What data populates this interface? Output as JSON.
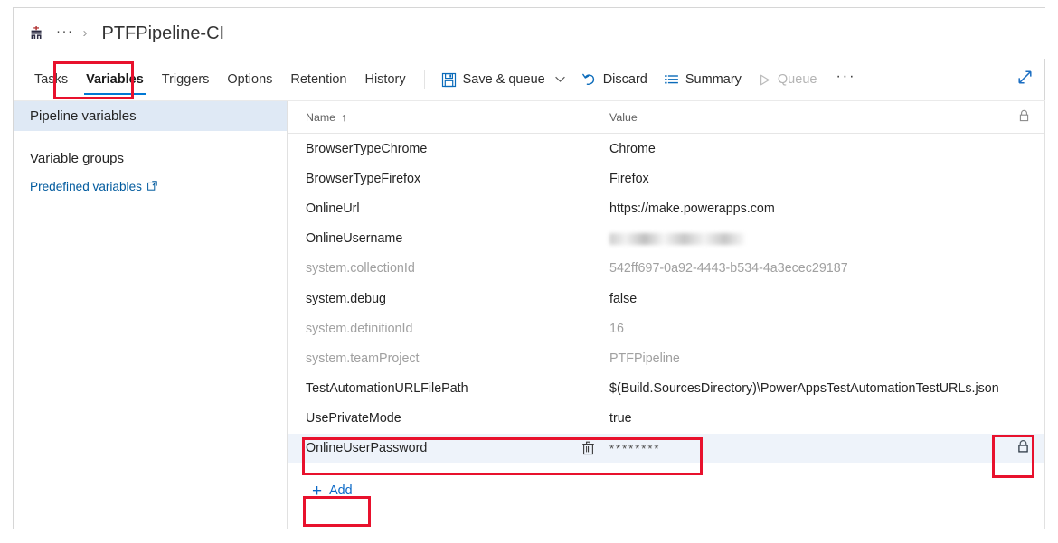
{
  "breadcrumb": {
    "pipeline_icon": "build-pipeline-icon",
    "ellipsis": "···",
    "separator": "›",
    "title": "PTFPipeline-CI"
  },
  "tabs": [
    {
      "label": "Tasks",
      "active": false
    },
    {
      "label": "Variables",
      "active": true
    },
    {
      "label": "Triggers",
      "active": false
    },
    {
      "label": "Options",
      "active": false
    },
    {
      "label": "Retention",
      "active": false
    },
    {
      "label": "History",
      "active": false
    }
  ],
  "commands": {
    "save_queue": "Save & queue",
    "discard": "Discard",
    "summary": "Summary",
    "queue": "Queue",
    "overflow": "···",
    "expand": "expand-icon"
  },
  "sidebar": {
    "items": [
      {
        "label": "Pipeline variables",
        "selected": true
      },
      {
        "label": "Variable groups",
        "selected": false
      }
    ],
    "link": {
      "label": "Predefined variables",
      "external_icon": "external-link-icon"
    }
  },
  "table": {
    "columns": {
      "name": "Name",
      "sort_arrow": "↑",
      "value": "Value",
      "lock": "lock-icon"
    },
    "rows": [
      {
        "name": "BrowserTypeChrome",
        "value": "Chrome",
        "muted": false,
        "kind": "text"
      },
      {
        "name": "BrowserTypeFirefox",
        "value": "Firefox",
        "muted": false,
        "kind": "text"
      },
      {
        "name": "OnlineUrl",
        "value": "https://make.powerapps.com",
        "muted": false,
        "kind": "text"
      },
      {
        "name": "OnlineUsername",
        "value": "",
        "muted": false,
        "kind": "redacted"
      },
      {
        "name": "system.collectionId",
        "value": "542ff697-0a92-4443-b534-4a3ecec29187",
        "muted": true,
        "kind": "text"
      },
      {
        "name": "system.debug",
        "value": "false",
        "muted": false,
        "kind": "text"
      },
      {
        "name": "system.definitionId",
        "value": "16",
        "muted": true,
        "kind": "text"
      },
      {
        "name": "system.teamProject",
        "value": "PTFPipeline",
        "muted": true,
        "kind": "text"
      },
      {
        "name": "TestAutomationURLFilePath",
        "value": "$(Build.SourcesDirectory)\\PowerAppsTestAutomationTestURLs.json",
        "muted": false,
        "kind": "text"
      },
      {
        "name": "UsePrivateMode",
        "value": "true",
        "muted": false,
        "kind": "text"
      },
      {
        "name": "OnlineUserPassword",
        "value": "********",
        "muted": false,
        "kind": "secret",
        "selected": true,
        "delete_icon": "trash-icon",
        "lock_icon": "lock-closed-icon"
      }
    ],
    "add_button": {
      "plus": "+",
      "label": "Add"
    }
  },
  "annotations": {
    "color": "#e8112d",
    "boxes": [
      {
        "name": "variables-tab-highlight"
      },
      {
        "name": "password-row-highlight"
      },
      {
        "name": "lock-toggle-highlight"
      },
      {
        "name": "add-button-highlight"
      }
    ]
  }
}
